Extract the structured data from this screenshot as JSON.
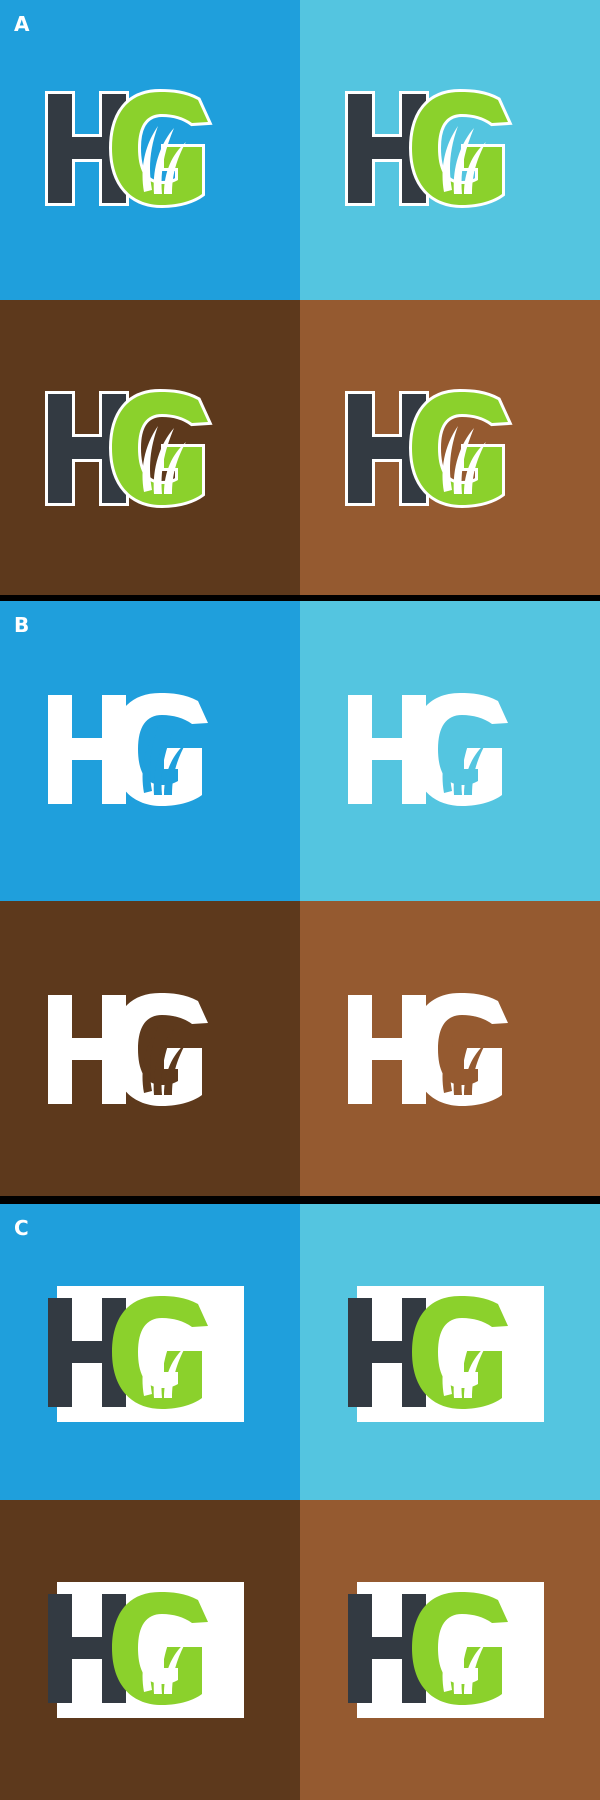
{
  "labels": {
    "a": "A",
    "b": "B",
    "c": "C"
  },
  "logo_text": {
    "h": "H",
    "g": "G"
  },
  "colors": {
    "blue": "#1f9fdc",
    "light_blue": "#54c5e0",
    "dark_brown": "#5d391c",
    "brown": "#955a30",
    "charcoal": "#333a42",
    "green": "#8bd12c",
    "white": "#ffffff",
    "divider": "#000000"
  }
}
